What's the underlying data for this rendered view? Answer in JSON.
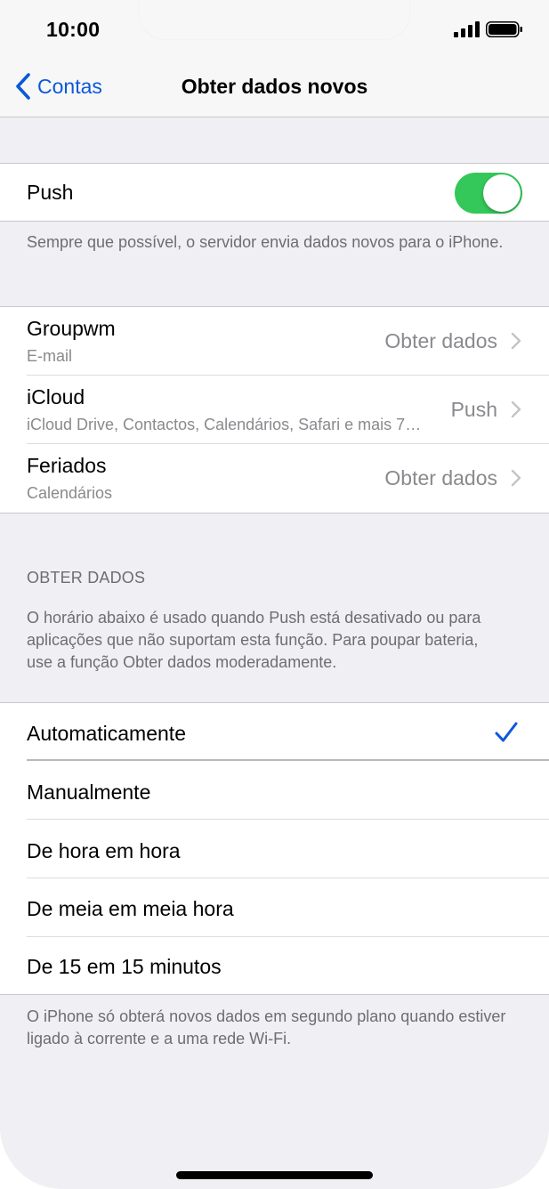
{
  "status_bar": {
    "time": "10:00"
  },
  "nav": {
    "back_label": "Contas",
    "title": "Obter dados novos"
  },
  "push": {
    "label": "Push",
    "enabled": true,
    "footnote": "Sempre que possível, o servidor envia dados novos para o iPhone."
  },
  "accounts": [
    {
      "name": "Groupwm",
      "subtitle": "E-mail",
      "value": "Obter dados"
    },
    {
      "name": "iCloud",
      "subtitle": "iCloud Drive, Contactos, Calendários, Safari e mais 7…",
      "value": "Push"
    },
    {
      "name": "Feriados",
      "subtitle": "Calendários",
      "value": "Obter dados"
    }
  ],
  "fetch_section": {
    "header": "OBTER DADOS",
    "description": "O horário abaixo é usado quando Push está desativado ou para aplicações que não suportam esta função. Para poupar bateria, use a função Obter dados moderadamente."
  },
  "schedule_options": [
    {
      "label": "Automaticamente",
      "selected": true
    },
    {
      "label": "Manualmente",
      "selected": false
    },
    {
      "label": "De hora em hora",
      "selected": false
    },
    {
      "label": "De meia em meia hora",
      "selected": false
    },
    {
      "label": "De 15 em 15 minutos",
      "selected": false
    }
  ],
  "bottom_footnote": "O iPhone só obterá novos dados em segundo plano quando estiver ligado à corrente e a uma rede Wi-Fi.",
  "icons": {
    "back": "chevron-left-icon",
    "disclosure": "chevron-right-icon",
    "selected": "checkmark-icon",
    "signal": "cellular-signal-icon",
    "battery": "battery-icon"
  },
  "colors": {
    "accent": "#0a59d8",
    "toggle_on": "#34c759",
    "background": "#efeff4",
    "secondary_text": "#8a8a8e"
  }
}
